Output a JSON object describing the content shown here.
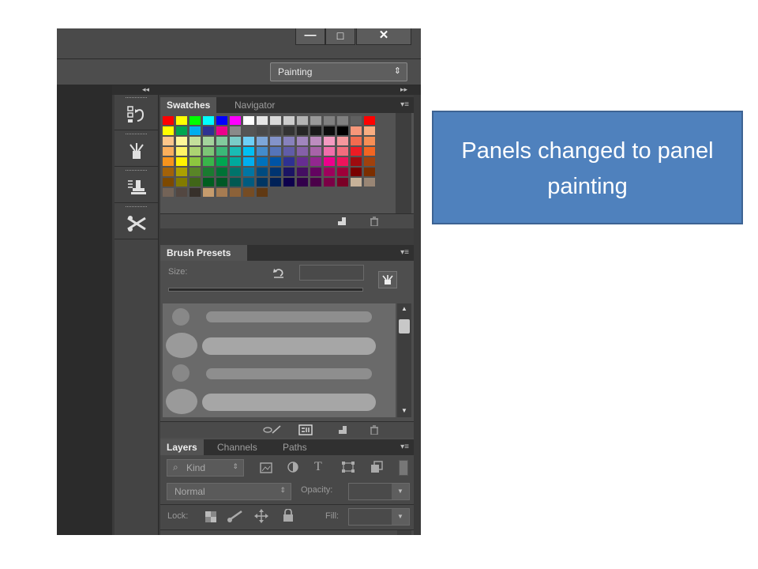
{
  "window": {
    "minimize_label": "—",
    "maximize_label": "□",
    "close_label": "✕"
  },
  "options_bar": {
    "workspace_value": "Painting",
    "workspace_arrow": "⇕"
  },
  "dock": {
    "collapse_left": "◂◂",
    "collapse_right": "▸▸"
  },
  "icon_strip": [
    {
      "icon": "history-icon",
      "glyph": "⊟↺"
    },
    {
      "icon": "brush-icon",
      "glyph": "✎"
    },
    {
      "icon": "clone-source-icon",
      "glyph": "⊞"
    },
    {
      "icon": "tool-presets-icon",
      "glyph": "✂"
    }
  ],
  "swatches_panel": {
    "tabs": [
      "Swatches",
      "Navigator"
    ],
    "menu_icon": "▾≡",
    "colors": [
      [
        "#ff0000",
        "#ffff00",
        "#00ff00",
        "#00ffff",
        "#0000ff",
        "#ff00ff",
        "#ffffff",
        "#e6e6e6",
        "#d9d9d9",
        "#cccccc",
        "#b3b3b3",
        "#999999",
        "#808080",
        "#808080",
        "#606060",
        "#ff0000"
      ],
      [
        "#ffff00",
        "#00a651",
        "#00aeef",
        "#2e3192",
        "#ec008c",
        "#8a8a8a",
        "#555555",
        "#4a4a4a",
        "#404040",
        "#333333",
        "#262626",
        "#1a1a1a",
        "#0d0d0d",
        "#000000",
        "#f7977a",
        "#f9ad81"
      ],
      [
        "#fdc68a",
        "#fff79a",
        "#c4df9b",
        "#a3d39c",
        "#82ca9d",
        "#7accc8",
        "#6dcff6",
        "#7da7d9",
        "#8393ca",
        "#8781bd",
        "#a186be",
        "#bd8cbf",
        "#f49ac1",
        "#f5989d",
        "#f26c4f",
        "#f68e55"
      ],
      [
        "#fbaf5c",
        "#fff467",
        "#acd372",
        "#7cc576",
        "#3bb878",
        "#1abbb4",
        "#00bff3",
        "#438ccb",
        "#5574b9",
        "#605ca8",
        "#8560a8",
        "#a763a8",
        "#f06eaa",
        "#f26d7d",
        "#ed1c24",
        "#f26522"
      ],
      [
        "#f7941d",
        "#fff200",
        "#8dc63f",
        "#39b54a",
        "#00a651",
        "#00a99d",
        "#00aeef",
        "#0072bc",
        "#0054a6",
        "#2e3192",
        "#662d91",
        "#92278f",
        "#ec008c",
        "#ed145b",
        "#9e0b0f",
        "#a0410d"
      ],
      [
        "#a36209",
        "#aba000",
        "#598527",
        "#1a7b30",
        "#007236",
        "#00746b",
        "#0076a3",
        "#004b80",
        "#003471",
        "#1b1464",
        "#440e62",
        "#630460",
        "#9e005d",
        "#9e0039",
        "#790000",
        "#7b2e00"
      ],
      [
        "#7d4900",
        "#827b00",
        "#406618",
        "#005e20",
        "#005826",
        "#005952",
        "#005b7f",
        "#003663",
        "#002157",
        "#0d004c",
        "#32004b",
        "#4b0049",
        "#7b0046",
        "#7a0026",
        "#c7b299",
        "#998675"
      ],
      [
        "#736357",
        "#534741",
        "#37302a",
        "#c69c6d",
        "#a67c52",
        "#8c6239",
        "#754c24",
        "#603913"
      ]
    ],
    "footer_icons": [
      "new-swatch-icon",
      "trash-icon"
    ]
  },
  "brush_presets_panel": {
    "tab": "Brush Presets",
    "size_label": "Size:",
    "reset_icon": "reset-icon",
    "toggle_icon": "brush-panel-toggle-icon",
    "footer_icons": [
      "toggle-brush-icon",
      "brush-settings-icon",
      "new-preset-icon",
      "trash-icon"
    ]
  },
  "layers_panel": {
    "tabs": [
      "Layers",
      "Channels",
      "Paths"
    ],
    "filter_label": "Kind",
    "filter_icons": [
      "image-filter-icon",
      "adjustment-filter-icon",
      "type-filter-icon",
      "shape-filter-icon",
      "smart-object-filter-icon"
    ],
    "blend_mode": "Normal",
    "opacity_label": "Opacity:",
    "opacity_value": "",
    "lock_label": "Lock:",
    "lock_icons": [
      "lock-transparent-icon",
      "lock-pixels-icon",
      "lock-position-icon",
      "lock-all-icon"
    ],
    "fill_label": "Fill:",
    "fill_value": ""
  },
  "annotation": {
    "line1": "Panels changed to panel",
    "line2": "painting"
  }
}
